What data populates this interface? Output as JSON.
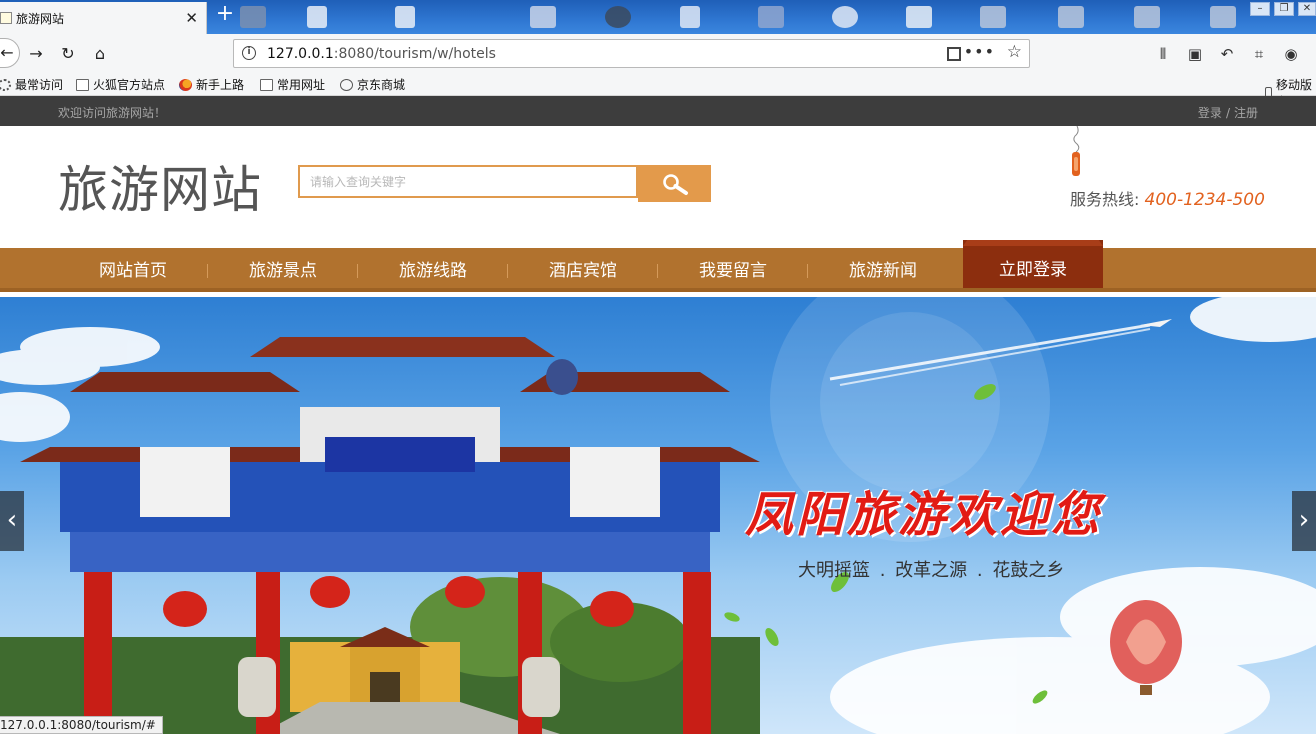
{
  "browser": {
    "tab_title": "旅游网站",
    "url_host": "127.0.0.1",
    "url_rest": ":8080/tourism/w/hotels",
    "status_url": "127.0.0.1:8080/tourism/#"
  },
  "bookmarks": [
    {
      "label": "最常访问",
      "icon": "gear-icon"
    },
    {
      "label": "火狐官方站点",
      "icon": "folder-icon"
    },
    {
      "label": "新手上路",
      "icon": "firefox-icon"
    },
    {
      "label": "常用网址",
      "icon": "folder-icon"
    },
    {
      "label": "京东商城",
      "icon": "globe-icon"
    },
    {
      "label": "移动版书",
      "icon": "mobile-icon"
    }
  ],
  "site": {
    "welcome": "欢迎访问旅游网站！",
    "login": "登录",
    "auth_sep": "/",
    "register": "注册",
    "logo": "旅游网站",
    "search_placeholder": "请输入查询关键字",
    "hotline_label": "服务热线:",
    "hotline_number": "400-1234-500",
    "nav": [
      "网站首页",
      "旅游景点",
      "旅游线路",
      "酒店宾馆",
      "我要留言",
      "旅游新闻"
    ],
    "nav_active": "立即登录",
    "banner_title": "凤阳旅游欢迎您",
    "banner_sub": "大明摇篮 . 改革之源 . 花鼓之乡"
  },
  "colors": {
    "nav_bg": "#b1722e",
    "nav_active_bg": "#8c2e0e",
    "search_accent": "#e39a4b",
    "hotline_number": "#e2621f",
    "topbar_bg": "#3d3d3d"
  }
}
